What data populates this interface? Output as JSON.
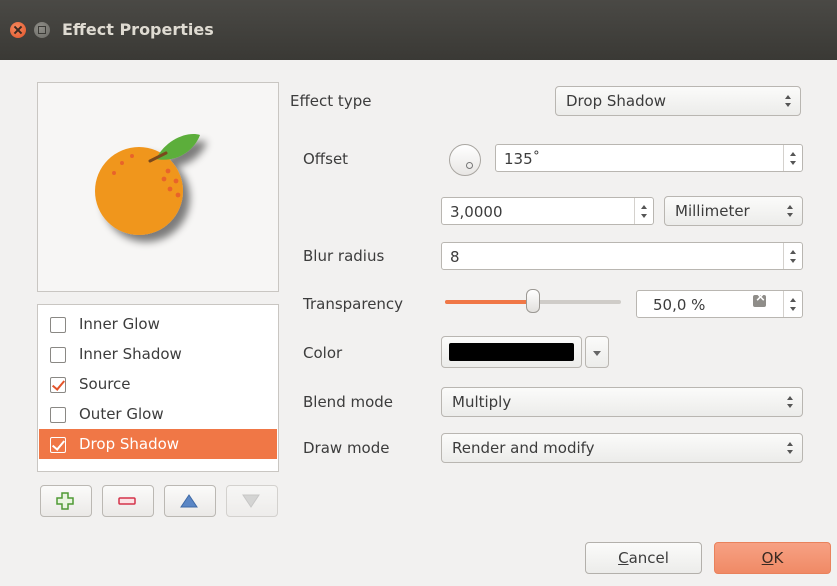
{
  "window": {
    "title": "Effect Properties"
  },
  "effects_list": [
    {
      "label": "Inner Glow",
      "checked": false,
      "selected": false
    },
    {
      "label": "Inner Shadow",
      "checked": false,
      "selected": false
    },
    {
      "label": "Source",
      "checked": true,
      "selected": false
    },
    {
      "label": "Outer Glow",
      "checked": false,
      "selected": false
    },
    {
      "label": "Drop Shadow",
      "checked": true,
      "selected": true
    }
  ],
  "toolbar": {
    "add_icon": "plus-icon",
    "remove_icon": "minus-icon",
    "up_icon": "arrow-up-icon",
    "down_icon": "arrow-down-icon"
  },
  "form": {
    "effect_type_label": "Effect type",
    "effect_type_value": "Drop Shadow",
    "offset_label": "Offset",
    "offset_angle": "135˚",
    "offset_distance": "3,0000",
    "offset_unit": "Millimeter",
    "blur_label": "Blur radius",
    "blur_value": "8",
    "transparency_label": "Transparency",
    "transparency_value": "50,0 %",
    "transparency_level": 0.5,
    "color_label": "Color",
    "color_value": "#000000",
    "blend_label": "Blend mode",
    "blend_value": "Multiply",
    "draw_label": "Draw mode",
    "draw_value": "Render and modify"
  },
  "buttons": {
    "cancel_first": "C",
    "cancel_rest": "ancel",
    "ok_first": "O",
    "ok_rest": "K"
  },
  "colors": {
    "accent": "#f07746",
    "titlebar": "#3c3b37",
    "orange_fruit": "#f0961f"
  }
}
